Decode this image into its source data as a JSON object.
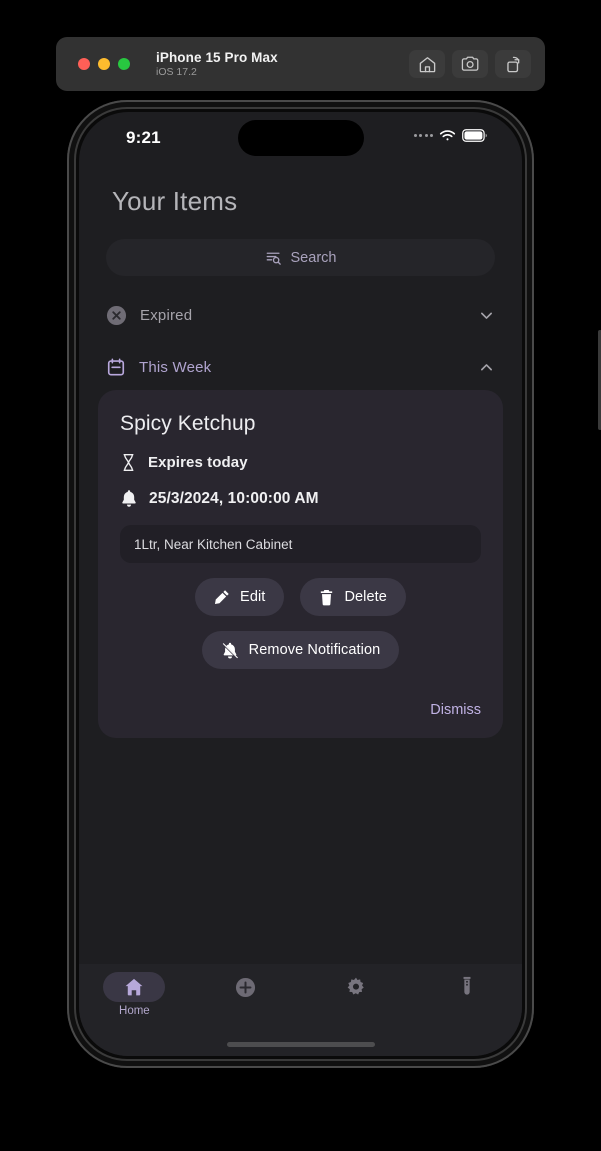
{
  "simulator": {
    "device_name": "iPhone 15 Pro Max",
    "os_version": "iOS 17.2",
    "window_buttons": [
      "close",
      "minimize",
      "zoom"
    ],
    "toolbar": [
      {
        "name": "home-icon",
        "label": "Home"
      },
      {
        "name": "screenshot-icon",
        "label": "Screenshot"
      },
      {
        "name": "rotate-icon",
        "label": "Rotate"
      }
    ]
  },
  "status_bar": {
    "time": "9:21",
    "cellular_icon": "cellular-dots-icon",
    "wifi_icon": "wifi-icon",
    "battery_icon": "battery-icon"
  },
  "app": {
    "page_title": "Your Items",
    "search": {
      "label": "Search",
      "icon": "text-search-icon"
    },
    "sections": [
      {
        "id": "expired",
        "label": "Expired",
        "icon": "circle-x-icon",
        "chevron": "chevron-down-icon",
        "expanded": false,
        "color": "#a5a3aa"
      },
      {
        "id": "this-week",
        "label": "This Week",
        "icon": "calendar-icon",
        "chevron": "chevron-up-icon",
        "expanded": true,
        "color": "#b0a4cf"
      }
    ],
    "card": {
      "title": "Spicy Ketchup",
      "expiry": {
        "icon": "hourglass-icon",
        "text": "Expires today"
      },
      "notification": {
        "icon": "bell-icon",
        "text": "25/3/2024, 10:00:00 AM"
      },
      "note": "1Ltr, Near Kitchen Cabinet",
      "actions": [
        {
          "id": "edit",
          "label": "Edit",
          "icon": "pencil-icon"
        },
        {
          "id": "delete",
          "label": "Delete",
          "icon": "trash-icon"
        },
        {
          "id": "remove-notification",
          "label": "Remove Notification",
          "icon": "bell-off-icon"
        }
      ],
      "dismiss_label": "Dismiss"
    },
    "bottom_nav": [
      {
        "id": "home",
        "label": "Home",
        "icon": "home-filled-icon",
        "active": true
      },
      {
        "id": "add",
        "label": "",
        "icon": "plus-circle-icon",
        "active": false
      },
      {
        "id": "settings",
        "label": "",
        "icon": "gear-icon",
        "active": false
      },
      {
        "id": "test-tube",
        "label": "",
        "icon": "test-tube-icon",
        "active": false
      }
    ]
  },
  "colors": {
    "app_background": "#1e1e21",
    "card_background": "#29262f",
    "pill_background": "#3b3845",
    "accent_purple": "#b0a4cf",
    "dismiss_purple": "#c0b2e4"
  }
}
